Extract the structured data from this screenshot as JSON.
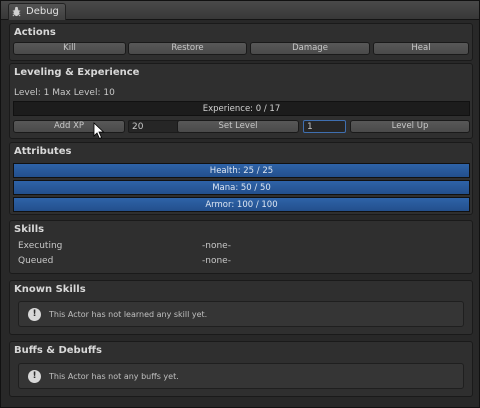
{
  "window": {
    "title": "Debug",
    "icon": "bug-icon"
  },
  "actions": {
    "title": "Actions",
    "buttons": [
      "Kill",
      "Restore",
      "Damage",
      "Heal"
    ]
  },
  "leveling": {
    "title": "Leveling & Experience",
    "level_text": "Level: 1 Max Level: 10",
    "experience_bar": {
      "label": "Experience: 0 / 17",
      "progress": 0
    },
    "add_xp_label": "Add XP",
    "add_xp_value": "20",
    "set_level_label": "Set Level",
    "set_level_value": "1",
    "level_up_label": "Level Up"
  },
  "attributes": {
    "title": "Attributes",
    "bars": [
      {
        "label": "Health: 25 / 25",
        "progress": 1.0
      },
      {
        "label": "Mana: 50 / 50",
        "progress": 1.0
      },
      {
        "label": "Armor: 100 / 100",
        "progress": 1.0
      }
    ]
  },
  "skills": {
    "title": "Skills",
    "rows": [
      {
        "label": "Executing",
        "value": "-none-"
      },
      {
        "label": "Queued",
        "value": "-none-"
      }
    ]
  },
  "known_skills": {
    "title": "Known Skills",
    "message": "This Actor has not learned any skill yet.",
    "icon": "info-icon"
  },
  "buffs": {
    "title": "Buffs & Debuffs",
    "message": "This Actor has not any buffs yet.",
    "icon": "info-icon"
  },
  "colors": {
    "panel": "#2f2f2f",
    "bar_blue": "#2a5b9c",
    "focus": "#3f6fb0"
  }
}
